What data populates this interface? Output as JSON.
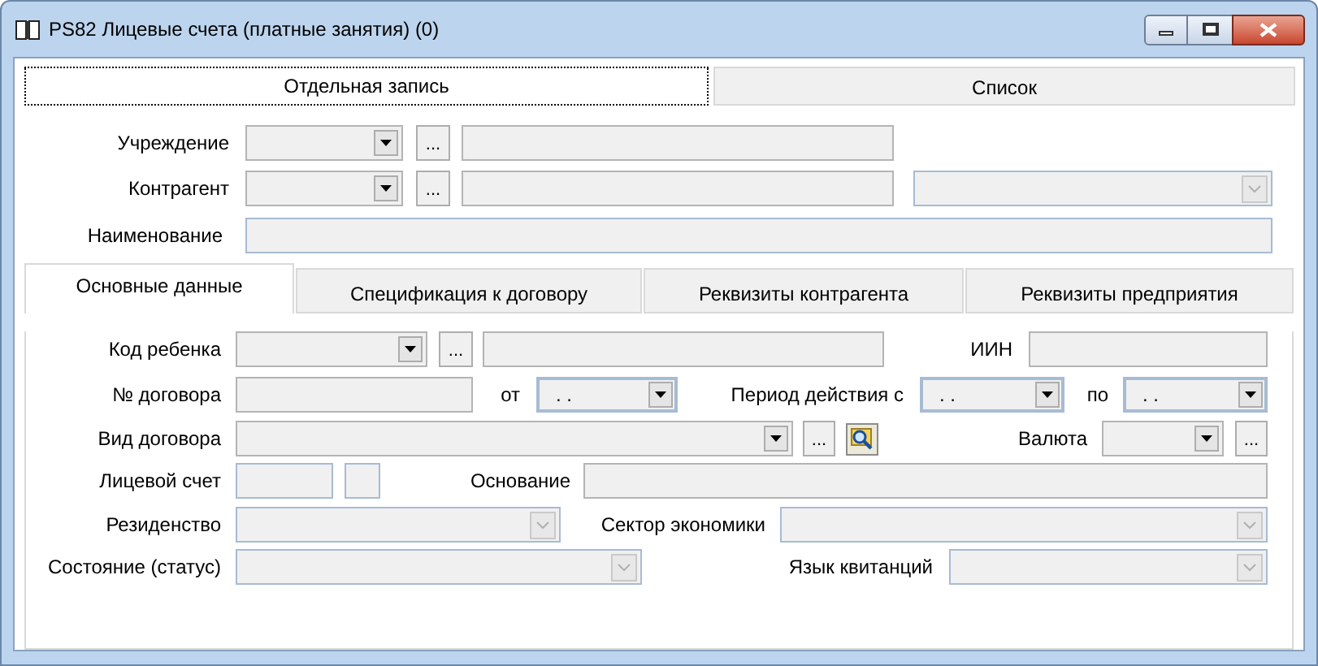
{
  "window": {
    "title": "PS82 Лицевые счета (платные занятия) (0)"
  },
  "top_tabs": [
    {
      "label": "Отдельная запись",
      "selected": true
    },
    {
      "label": "Список",
      "selected": false
    }
  ],
  "header_rows": [
    [
      {
        "kind": "label",
        "text": "Учреждение"
      },
      {
        "kind": "combo"
      },
      {
        "kind": "button",
        "text": "..."
      },
      {
        "kind": "text",
        "disabled": false
      }
    ],
    [
      {
        "kind": "label",
        "text": "Контрагент"
      },
      {
        "kind": "combo"
      },
      {
        "kind": "button",
        "text": "..."
      },
      {
        "kind": "text",
        "disabled": false
      },
      {
        "kind": "select"
      }
    ],
    [
      {
        "kind": "label",
        "text": "Наименование"
      },
      {
        "kind": "text",
        "disabled": true
      }
    ]
  ],
  "inner_tabs": [
    {
      "label": "Основные данные",
      "selected": true
    },
    {
      "label": "Спецификация к договору",
      "selected": false
    },
    {
      "label": "Реквизиты контрагента",
      "selected": false
    },
    {
      "label": "Реквизиты предприятия",
      "selected": false
    }
  ],
  "detail_rows": [
    [
      {
        "kind": "label",
        "text": "Код ребенка"
      },
      {
        "kind": "combo"
      },
      {
        "kind": "button",
        "text": "..."
      },
      {
        "kind": "text",
        "disabled": false
      },
      {
        "kind": "label",
        "text": "ИИН"
      },
      {
        "kind": "text",
        "disabled": false
      }
    ],
    [
      {
        "kind": "label",
        "text": "№ договора"
      },
      {
        "kind": "text",
        "disabled": false
      },
      {
        "kind": "label",
        "text": "от"
      },
      {
        "kind": "date",
        "value": ". ."
      },
      {
        "kind": "label",
        "text": "Период действия с"
      },
      {
        "kind": "date",
        "value": ". ."
      },
      {
        "kind": "label",
        "text": "по"
      },
      {
        "kind": "date",
        "value": ". ."
      }
    ],
    [
      {
        "kind": "label",
        "text": "Вид договора"
      },
      {
        "kind": "combo"
      },
      {
        "kind": "button",
        "text": "..."
      },
      {
        "kind": "lookup"
      },
      {
        "kind": "label",
        "text": "Валюта"
      },
      {
        "kind": "combo"
      },
      {
        "kind": "button",
        "text": "..."
      }
    ],
    [
      {
        "kind": "label",
        "text": "Лицевой счет"
      },
      {
        "kind": "text",
        "disabled": true
      },
      {
        "kind": "text",
        "disabled": true
      },
      {
        "kind": "label",
        "text": "Основание"
      },
      {
        "kind": "text",
        "disabled": false
      }
    ],
    [
      {
        "kind": "label",
        "text": "Резиденство"
      },
      {
        "kind": "select"
      },
      {
        "kind": "label",
        "text": "Сектор экономики"
      },
      {
        "kind": "select"
      }
    ],
    [
      {
        "kind": "label",
        "text": "Состояние (статус)"
      },
      {
        "kind": "select"
      },
      {
        "kind": "label",
        "text": "Язык квитанций"
      },
      {
        "kind": "select"
      }
    ]
  ]
}
